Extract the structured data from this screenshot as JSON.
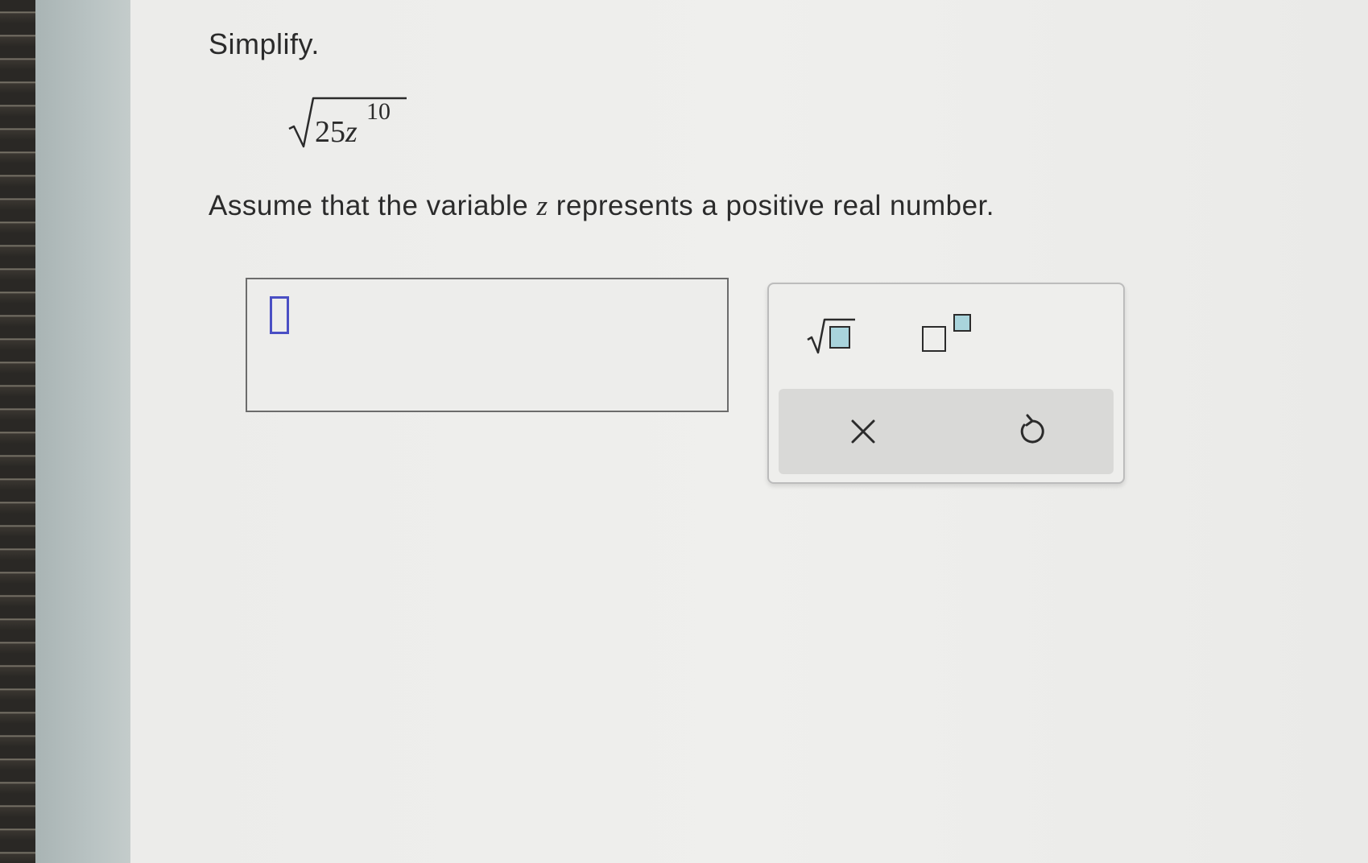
{
  "problem": {
    "instruction": "Simplify.",
    "expression": {
      "radicand": "25",
      "variable": "z",
      "exponent": "10"
    },
    "assumption": {
      "before": "Assume that the variable ",
      "variable": "z",
      "after": " represents a positive real number."
    }
  },
  "answer": {
    "value": ""
  },
  "toolbar": {
    "tools": [
      "sqrt-icon",
      "superscript-icon"
    ],
    "actions": [
      "clear-icon",
      "undo-icon"
    ]
  },
  "colors": {
    "accent": "#4a4fc4",
    "template_fill": "#a9d4dc"
  }
}
